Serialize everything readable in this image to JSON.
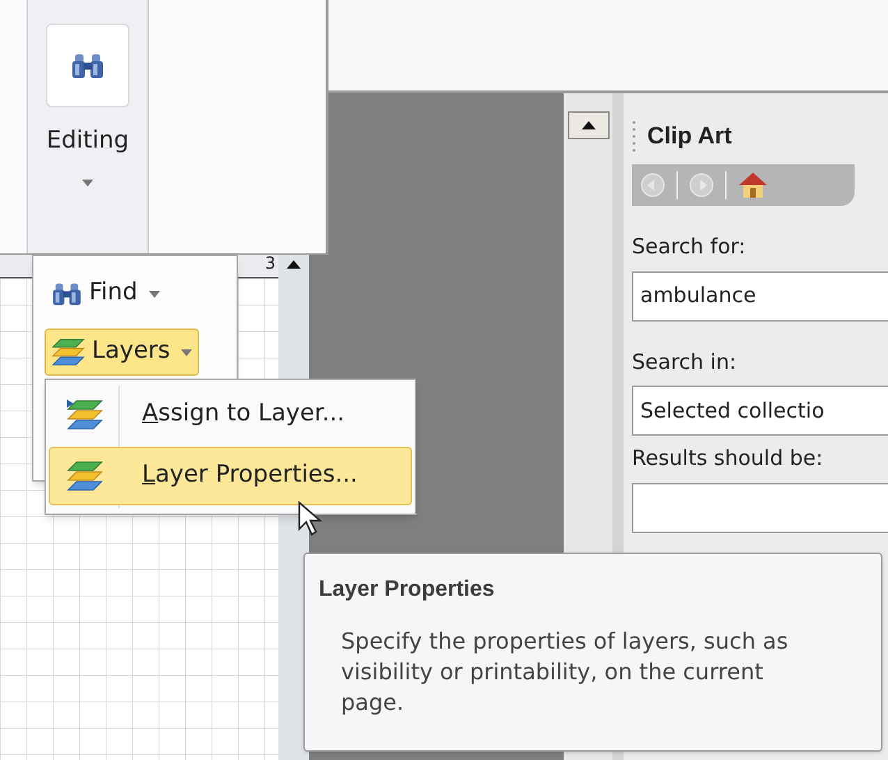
{
  "ribbon": {
    "group_label": "Editing"
  },
  "editing_menu": {
    "items": [
      {
        "label": "Find",
        "kind": "dropdown",
        "selected": false
      },
      {
        "label": "Layers",
        "kind": "dropdown",
        "selected": true
      }
    ]
  },
  "layers_submenu": {
    "items": [
      {
        "label": "Assign to Layer...",
        "kind": "assign",
        "selected": false
      },
      {
        "label": "Layer Properties...",
        "kind": "properties",
        "selected": true
      }
    ]
  },
  "ruler": {
    "label": "3"
  },
  "clip_art": {
    "title": "Clip Art",
    "search_for_label": "Search for:",
    "search_for_value": "ambulance",
    "search_in_label": "Search in:",
    "search_in_value": "Selected collectio",
    "results_label": "Results should be:"
  },
  "tooltip": {
    "title": "Layer Properties",
    "description": "Specify the properties of layers, such as visibility or printability, on the current page."
  }
}
